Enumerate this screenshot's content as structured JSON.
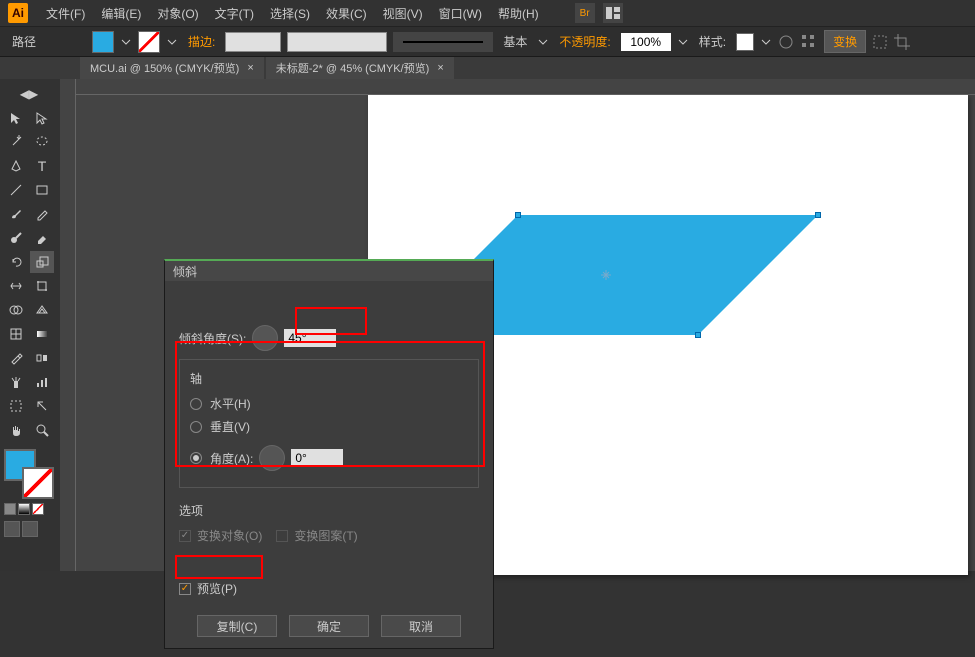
{
  "app": {
    "logo": "Ai"
  },
  "menu": [
    "文件(F)",
    "编辑(E)",
    "对象(O)",
    "文字(T)",
    "选择(S)",
    "效果(C)",
    "视图(V)",
    "窗口(W)",
    "帮助(H)"
  ],
  "control": {
    "path_label": "路径",
    "stroke_label": "描边:",
    "stroke_width": "",
    "line_style": "基本",
    "opacity_label": "不透明度:",
    "opacity_value": "100%",
    "style_label": "样式:",
    "transform_btn": "变换"
  },
  "tabs": [
    {
      "label": "MCU.ai @ 150% (CMYK/预览)"
    },
    {
      "label": "未标题-2* @ 45% (CMYK/预览)"
    }
  ],
  "dialog": {
    "title": "倾斜",
    "shear_angle_label": "倾斜角度(S):",
    "shear_angle_value": "45°",
    "axis_legend": "轴",
    "axis_h": "水平(H)",
    "axis_v": "垂直(V)",
    "axis_angle_label": "角度(A):",
    "axis_angle_value": "0°",
    "options_legend": "选项",
    "transform_obj": "变换对象(O)",
    "transform_pattern": "变换图案(T)",
    "preview": "预览(P)",
    "copy_btn": "复制(C)",
    "ok_btn": "确定",
    "cancel_btn": "取消"
  }
}
